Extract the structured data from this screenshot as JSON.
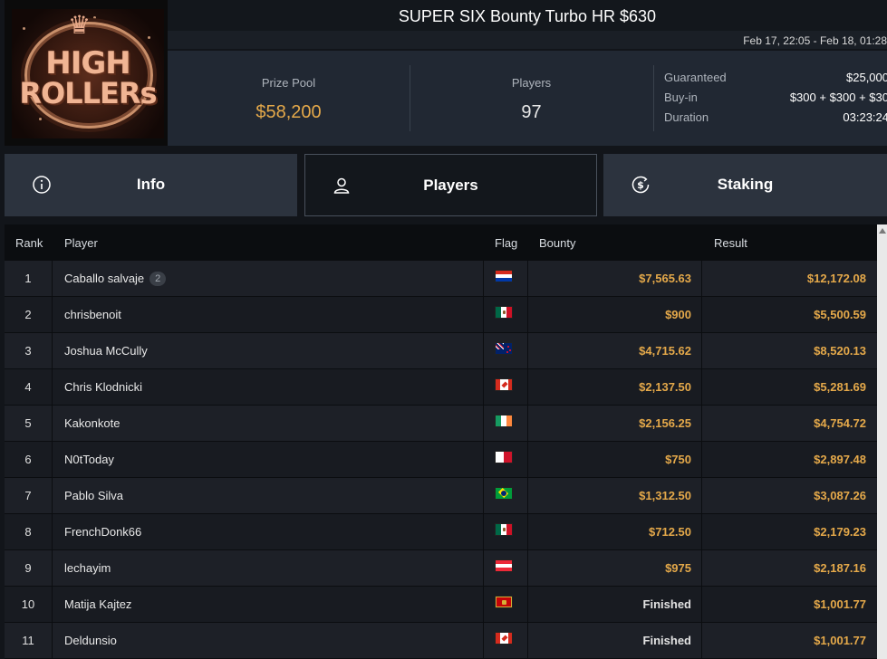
{
  "header": {
    "logo": {
      "line1": "HIGH",
      "line2": "ROLLERs"
    },
    "title": "SUPER SIX Bounty Turbo HR $630",
    "dates": "Feb 17, 22:05 - Feb 18, 01:28",
    "prize_pool": {
      "label": "Prize Pool",
      "value": "$58,200"
    },
    "players": {
      "label": "Players",
      "value": "97"
    },
    "details": [
      {
        "key": "Guaranteed",
        "value": "$25,000"
      },
      {
        "key": "Buy-in",
        "value": "$300 + $300 + $30"
      },
      {
        "key": "Duration",
        "value": "03:23:24"
      }
    ]
  },
  "tabs": [
    {
      "label": "Info",
      "icon": "info-icon",
      "active": false
    },
    {
      "label": "Players",
      "icon": "user-icon",
      "active": true
    },
    {
      "label": "Staking",
      "icon": "dollar-coin-icon",
      "active": false
    }
  ],
  "table": {
    "columns": {
      "rank": "Rank",
      "player": "Player",
      "flag": "Flag",
      "bounty": "Bounty",
      "result": "Result"
    },
    "rows": [
      {
        "rank": "1",
        "player": "Caballo salvaje",
        "entries": "2",
        "flag": "paraguay",
        "bounty": "$7,565.63",
        "result": "$12,172.08"
      },
      {
        "rank": "2",
        "player": "chrisbenoit",
        "entries": "",
        "flag": "mexico",
        "bounty": "$900",
        "result": "$5,500.59"
      },
      {
        "rank": "3",
        "player": "Joshua McCully",
        "entries": "",
        "flag": "new-zealand",
        "bounty": "$4,715.62",
        "result": "$8,520.13"
      },
      {
        "rank": "4",
        "player": "Chris Klodnicki",
        "entries": "",
        "flag": "canada",
        "bounty": "$2,137.50",
        "result": "$5,281.69"
      },
      {
        "rank": "5",
        "player": "Kakonkote",
        "entries": "",
        "flag": "ireland",
        "bounty": "$2,156.25",
        "result": "$4,754.72"
      },
      {
        "rank": "6",
        "player": "N0tToday",
        "entries": "",
        "flag": "malta",
        "bounty": "$750",
        "result": "$2,897.48"
      },
      {
        "rank": "7",
        "player": "Pablo Silva",
        "entries": "",
        "flag": "brazil",
        "bounty": "$1,312.50",
        "result": "$3,087.26"
      },
      {
        "rank": "8",
        "player": "FrenchDonk66",
        "entries": "",
        "flag": "mexico",
        "bounty": "$712.50",
        "result": "$2,179.23"
      },
      {
        "rank": "9",
        "player": "lechayim",
        "entries": "",
        "flag": "austria",
        "bounty": "$975",
        "result": "$2,187.16"
      },
      {
        "rank": "10",
        "player": "Matija Kajtez",
        "entries": "",
        "flag": "montenegro",
        "bounty": "Finished",
        "result": "$1,001.77"
      },
      {
        "rank": "11",
        "player": "Deldunsio",
        "entries": "",
        "flag": "canada",
        "bounty": "Finished",
        "result": "$1,001.77"
      }
    ]
  },
  "colors": {
    "accent_gold": "#e5a94a",
    "background": "#12151a",
    "panel": "#212833",
    "tab": "#2c333e"
  }
}
